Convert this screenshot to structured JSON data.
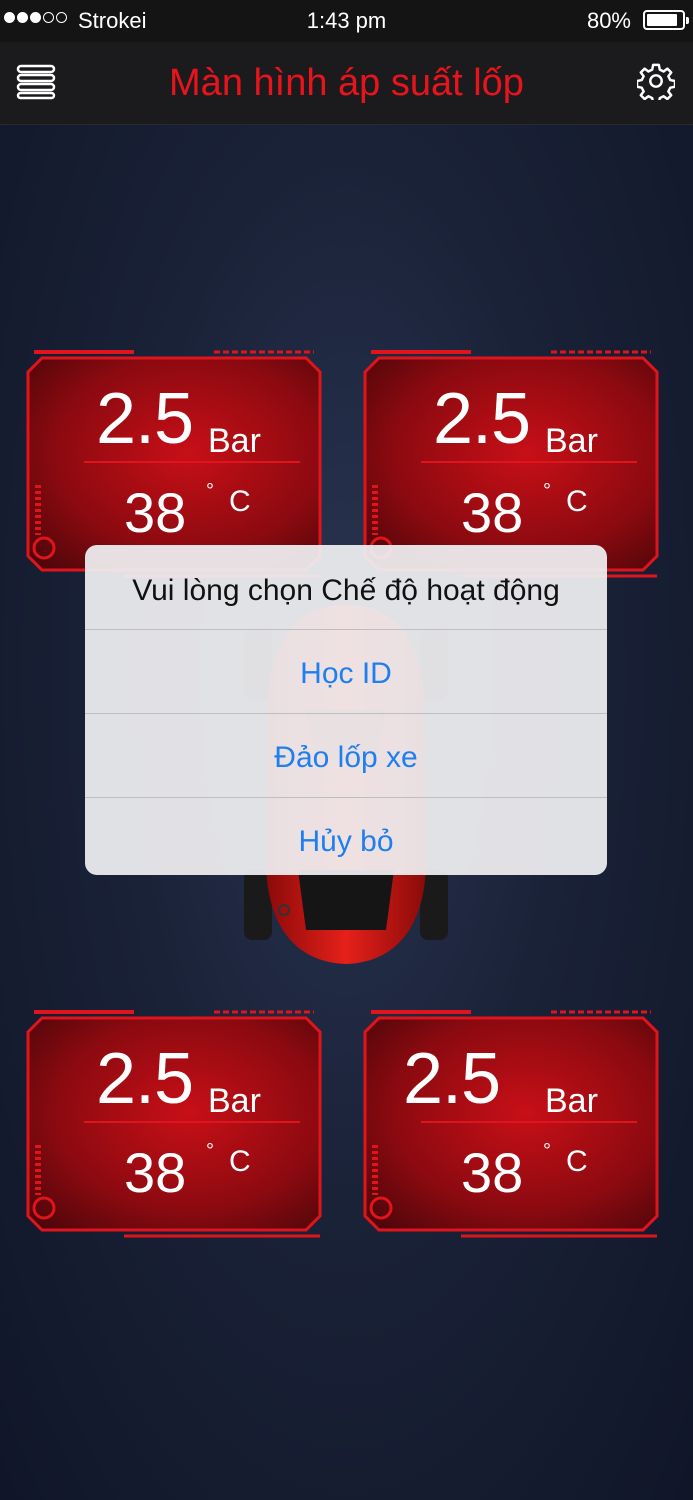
{
  "status_bar": {
    "carrier": "Strokei",
    "time": "1:43 pm",
    "battery": "80%"
  },
  "nav": {
    "title": "Màn hình áp suất lốp",
    "menu_icon": "menu-icon",
    "settings_icon": "gear-icon"
  },
  "tires": [
    {
      "position": "front-left",
      "pressure": "2.5",
      "unit": "Bar",
      "temperature": "38",
      "degree": "°",
      "temp_unit": "C"
    },
    {
      "position": "front-right",
      "pressure": "2.5",
      "unit": "Bar",
      "temperature": "38",
      "degree": "°",
      "temp_unit": "C"
    },
    {
      "position": "rear-left",
      "pressure": "2.5",
      "unit": "Bar",
      "temperature": "38",
      "degree": "°",
      "temp_unit": "C"
    },
    {
      "position": "rear-right",
      "pressure": "2.5",
      "unit": "Bar",
      "temperature": "38",
      "degree": "°",
      "temp_unit": "C"
    }
  ],
  "dialog": {
    "title": "Vui lòng chọn Chế độ hoạt động",
    "options": [
      "Học ID",
      "Đảo lốp xe",
      "Hủy bỏ"
    ]
  },
  "colors": {
    "accent": "#e8141c",
    "link": "#1d7ff0",
    "background": "#1a2238"
  }
}
